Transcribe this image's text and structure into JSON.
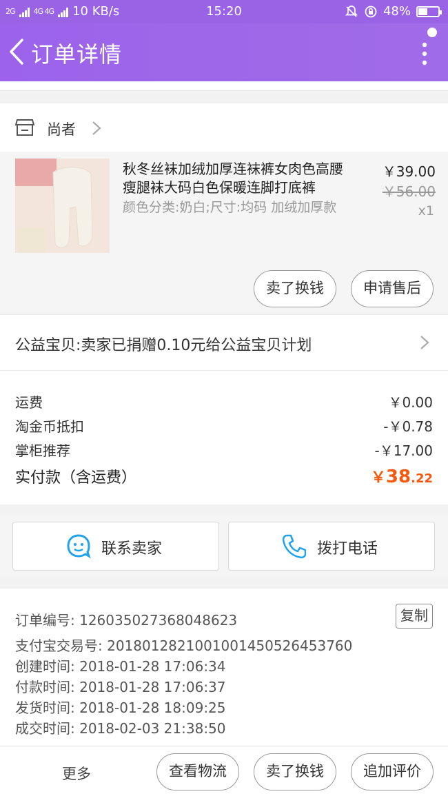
{
  "status_bar": {
    "network_1": "2G",
    "network_2": "4G 4G",
    "speed": "10 KB/s",
    "time": "15:20",
    "battery": "48%",
    "battery_level": 0.48
  },
  "header": {
    "title": "订单详情"
  },
  "shop": {
    "name": "尚者"
  },
  "item": {
    "title": "秋冬丝袜加绒加厚连袜裤女肉色高腰瘦腿袜大码白色保暖连脚打底裤",
    "sku": "颜色分类:奶白;尺寸:均码 加绒加厚款",
    "price": "￥39.00",
    "original_price": "￥56.00",
    "quantity": "x1",
    "actions": [
      "卖了换钱",
      "申请售后"
    ]
  },
  "charity": {
    "text": "公益宝贝:卖家已捐赠0.10元给公益宝贝计划"
  },
  "costs": {
    "rows": [
      {
        "label": "运费",
        "value": "￥0.00"
      },
      {
        "label": "淘金币抵扣",
        "value": "-￥0.78"
      },
      {
        "label": "掌柜推荐",
        "value": "-￥17.00"
      }
    ],
    "total_label": "实付款（含运费）",
    "total_symbol": "￥",
    "total_int": "38",
    "total_dec": ".22"
  },
  "contact": {
    "seller": "联系卖家",
    "call": "拨打电话"
  },
  "order_info": {
    "order_no": "订单编号: 126035027368048623",
    "alipay_no": "支付宝交易号: 2018012821001001450526453760",
    "created": "创建时间: 2018-01-28 17:06:34",
    "paid": "付款时间: 2018-01-28 17:06:37",
    "shipped": "发货时间: 2018-01-28 18:09:25",
    "completed": "成交时间: 2018-02-03 21:38:50",
    "copy_label": "复制"
  },
  "bottom_bar": {
    "more": "更多",
    "buttons": [
      "查看物流",
      "卖了换钱",
      "追加评价"
    ]
  },
  "colors": {
    "header": "#9c63ea",
    "accent": "#f35a10",
    "seller_icon": "#1fa3ec"
  }
}
